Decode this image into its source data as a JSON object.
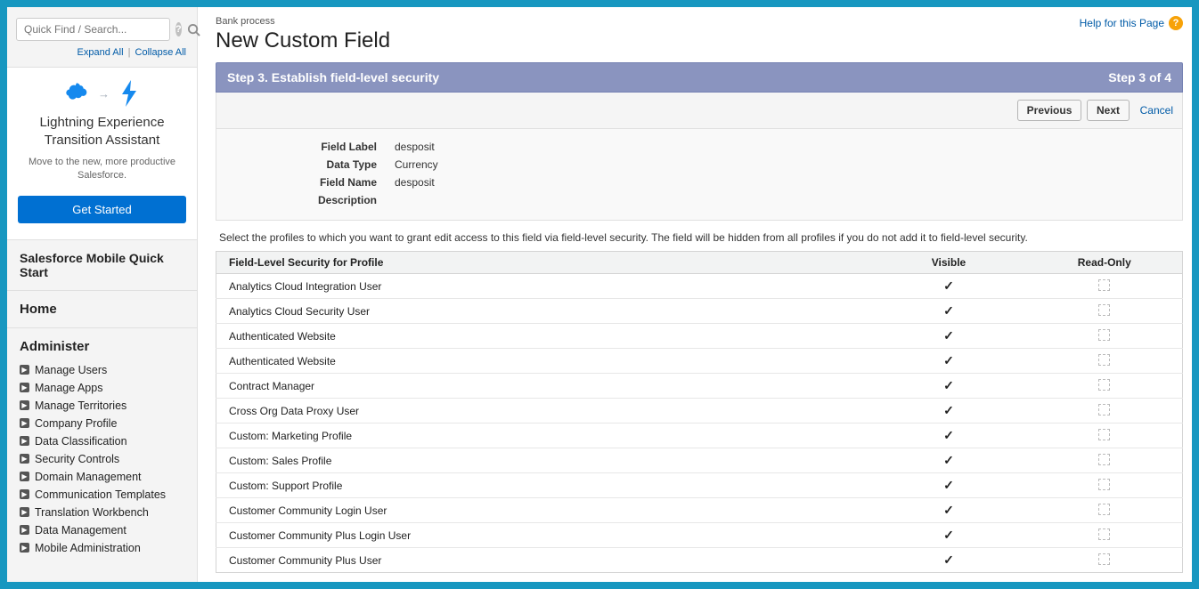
{
  "sidebar": {
    "search_placeholder": "Quick Find / Search...",
    "expand_label": "Expand All",
    "collapse_label": "Collapse All",
    "promo": {
      "title": "Lightning Experience Transition Assistant",
      "subtitle": "Move to the new, more productive Salesforce.",
      "button": "Get Started"
    },
    "quickstart_title": "Salesforce Mobile Quick Start",
    "home_title": "Home",
    "administer_title": "Administer",
    "administer_items": [
      "Manage Users",
      "Manage Apps",
      "Manage Territories",
      "Company Profile",
      "Data Classification",
      "Security Controls",
      "Domain Management",
      "Communication Templates",
      "Translation Workbench",
      "Data Management",
      "Mobile Administration"
    ]
  },
  "header": {
    "breadcrumb": "Bank process",
    "title": "New Custom Field",
    "help_label": "Help for this Page"
  },
  "step": {
    "title": "Step 3. Establish field-level security",
    "counter": "Step 3 of 4"
  },
  "buttons": {
    "previous": "Previous",
    "next": "Next",
    "cancel": "Cancel"
  },
  "meta": {
    "field_label_label": "Field Label",
    "field_label_value": "desposit",
    "data_type_label": "Data Type",
    "data_type_value": "Currency",
    "field_name_label": "Field Name",
    "field_name_value": "desposit",
    "description_label": "Description",
    "description_value": ""
  },
  "instruction": "Select the profiles to which you want to grant edit access to this field via field-level security. The field will be hidden from all profiles if you do not add it to field-level security.",
  "table": {
    "col_profile": "Field-Level Security for Profile",
    "col_visible": "Visible",
    "col_readonly": "Read-Only",
    "rows": [
      {
        "name": "Analytics Cloud Integration User",
        "visible": true,
        "readonly": false
      },
      {
        "name": "Analytics Cloud Security User",
        "visible": true,
        "readonly": false
      },
      {
        "name": "Authenticated Website",
        "visible": true,
        "readonly": false
      },
      {
        "name": "Authenticated Website",
        "visible": true,
        "readonly": false
      },
      {
        "name": "Contract Manager",
        "visible": true,
        "readonly": false
      },
      {
        "name": "Cross Org Data Proxy User",
        "visible": true,
        "readonly": false
      },
      {
        "name": "Custom: Marketing Profile",
        "visible": true,
        "readonly": false
      },
      {
        "name": "Custom: Sales Profile",
        "visible": true,
        "readonly": false
      },
      {
        "name": "Custom: Support Profile",
        "visible": true,
        "readonly": false
      },
      {
        "name": "Customer Community Login User",
        "visible": true,
        "readonly": false
      },
      {
        "name": "Customer Community Plus Login User",
        "visible": true,
        "readonly": false
      },
      {
        "name": "Customer Community Plus User",
        "visible": true,
        "readonly": false
      }
    ]
  }
}
